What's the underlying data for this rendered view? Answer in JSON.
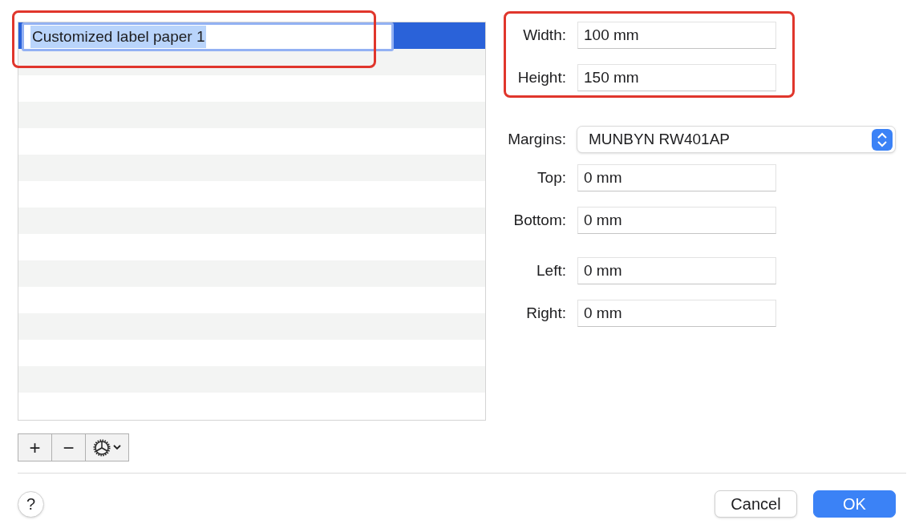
{
  "paper_list": {
    "rows": [
      {
        "name": "Customized label paper 1",
        "selected": true
      }
    ]
  },
  "list_buttons": [
    {
      "kind": "add",
      "label": "+"
    },
    {
      "kind": "remove",
      "label": "−"
    },
    {
      "kind": "menu"
    }
  ],
  "size_fields": [
    {
      "label": "Width:",
      "value": "100 mm"
    },
    {
      "label": "Height:",
      "value": "150 mm"
    }
  ],
  "margins": {
    "label": "Margins:",
    "value": "MUNBYN RW401AP"
  },
  "margin_fields": [
    {
      "label": "Top:",
      "value": "0 mm"
    },
    {
      "label": "Bottom:",
      "value": "0 mm"
    },
    {
      "label": "Left:",
      "value": "0 mm"
    },
    {
      "label": "Right:",
      "value": "0 mm"
    }
  ],
  "help_button": "?",
  "buttons": [
    {
      "label": "Cancel",
      "kind": "secondary"
    },
    {
      "label": "OK",
      "kind": "default"
    }
  ]
}
